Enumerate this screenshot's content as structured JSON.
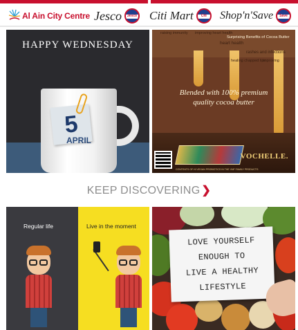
{
  "brands": {
    "al_ain_city_centre": "Al Ain City Centre",
    "jesco": "Jesco",
    "jesco_badge": "Jesco",
    "citi_mart": "Citi Mart",
    "citi_badge": "Citi",
    "shop_n_save": "Shop'n'Save",
    "shop_badge": "Save"
  },
  "tiles": {
    "wednesday": {
      "headline": "HAPPY WEDNESDAY",
      "day": "5",
      "month": "APRIL"
    },
    "cocoa": {
      "tags": [
        "raising immunity",
        "improving heart health",
        "Surprising Benefits of Cocoa Butter",
        "heart health",
        "rashes and infections",
        "healing chapped lips",
        "improving"
      ],
      "callout_line1": "Blended with 100% premium",
      "callout_line2": "quality cocoa butter",
      "brand": "VOCHELLE.",
      "fine_print": "CONTENTS OF HI VEGAN PROBIOTICS IN THE VNF FAMILY PRODUCTS"
    },
    "life": {
      "left_caption": "Regular life",
      "right_caption": "Live in the moment"
    },
    "love": {
      "line1": "LOVE YOURSELF",
      "line2": "ENOUGH TO",
      "line3": "LIVE A HEALTHY",
      "line4": "LIFESTYLE"
    }
  },
  "section": {
    "heading": "KEEP DISCOVERING",
    "chevron": "❯"
  },
  "colors": {
    "brand_red": "#c8102e",
    "heading_grey": "#8d8d8d",
    "yellow_panel": "#f6de21"
  }
}
